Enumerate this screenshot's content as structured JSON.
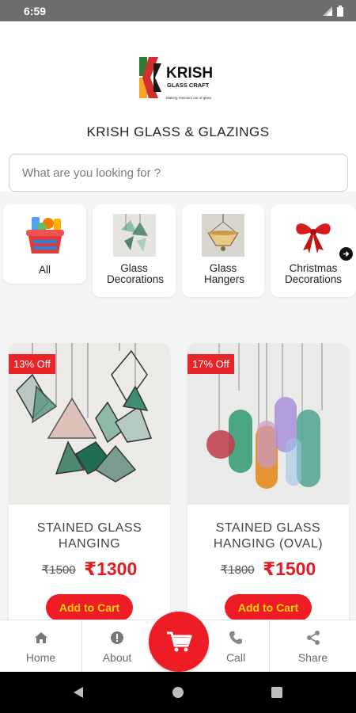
{
  "status_bar": {
    "time": "6:59"
  },
  "header": {
    "logo_text": "KRISH",
    "logo_subtext": "GLASS CRAFT",
    "logo_tagline": "Making memoirs out of glass",
    "store_title": "KRISH GLASS & GLAZINGS"
  },
  "search": {
    "placeholder": "What are you looking for ?"
  },
  "categories": [
    {
      "label": "All",
      "icon": "basket-icon"
    },
    {
      "label": "Glass Decorations",
      "icon": "glass-decoration-image"
    },
    {
      "label": "Glass Hangers",
      "icon": "glass-hanger-image"
    },
    {
      "label": "Christmas Decorations",
      "icon": "christmas-bow-image"
    }
  ],
  "products": [
    {
      "badge": "13% Off",
      "name": "STAINED GLASS HANGING",
      "old_price": "₹1500",
      "price": "₹1300",
      "cart_label": "Add to Cart"
    },
    {
      "badge": "17% Off",
      "name": "STAINED GLASS HANGING (OVAL)",
      "old_price": "₹1800",
      "price": "₹1500",
      "cart_label": "Add to Cart"
    }
  ],
  "bottom_nav": [
    {
      "label": "Home",
      "icon": "home-icon"
    },
    {
      "label": "About",
      "icon": "info-icon"
    },
    {
      "label": "Call",
      "icon": "phone-icon"
    },
    {
      "label": "Share",
      "icon": "share-icon"
    }
  ],
  "colors": {
    "accent": "#ee1c24",
    "cart_text": "#ffd400",
    "badge": "#e8262a"
  }
}
